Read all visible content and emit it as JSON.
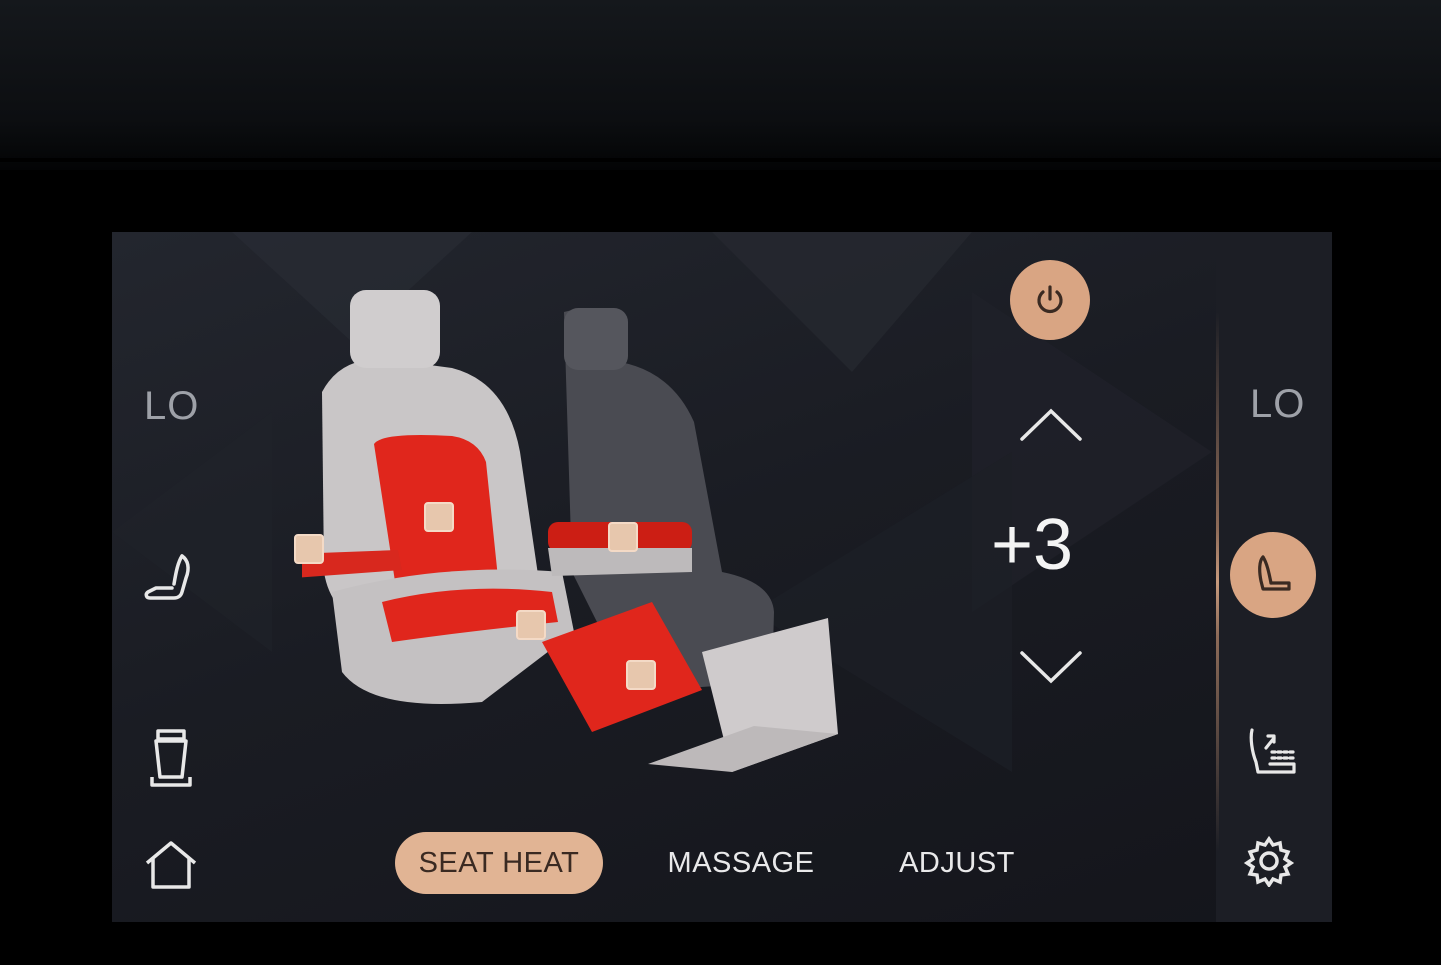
{
  "left_panel": {
    "heat_level_label": "LO",
    "seat_icon": "seat-icon",
    "cupholder_icon": "cupholder-icon",
    "home_icon": "home-icon"
  },
  "right_panel": {
    "heat_level_label": "LO",
    "active_seat_icon": "seat-icon",
    "recline_icon": "seat-recline-icon",
    "settings_icon": "gear-icon"
  },
  "controls": {
    "power_icon": "power-icon",
    "up_icon": "chevron-up-icon",
    "down_icon": "chevron-down-icon",
    "level_value": "+3"
  },
  "tabs": [
    {
      "label": "SEAT HEAT",
      "active": true
    },
    {
      "label": "MASSAGE",
      "active": false
    },
    {
      "label": "ADJUST",
      "active": false
    }
  ],
  "colors": {
    "accent": "#e1b494",
    "heat_zone": "#e0261c",
    "background": "#1b1d24",
    "text": "#e9e9ea"
  }
}
